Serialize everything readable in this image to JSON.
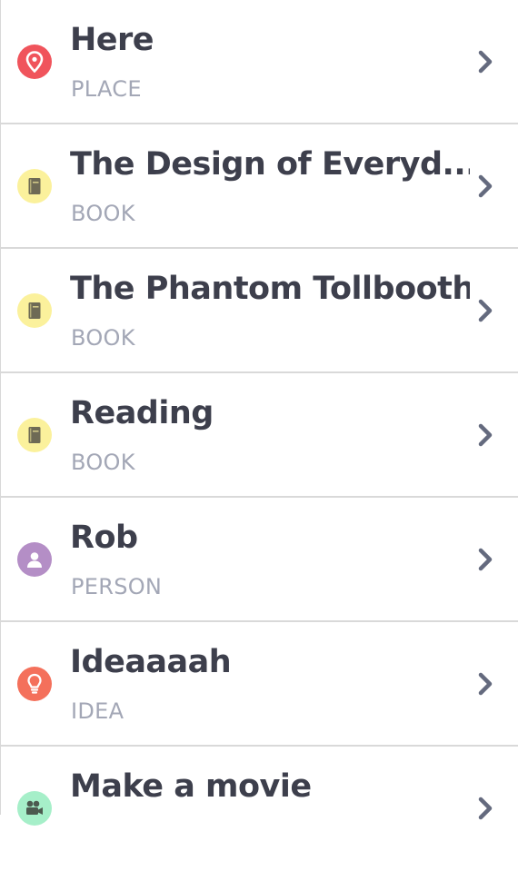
{
  "items": [
    {
      "title": "Here",
      "type": "PLACE",
      "icon": "location-pin-icon",
      "color": "#f0545c"
    },
    {
      "title": "The Design of Everyd...",
      "type": "BOOK",
      "icon": "book-icon",
      "color": "#fbf19c"
    },
    {
      "title": "The Phantom Tollbooth",
      "type": "BOOK",
      "icon": "book-icon",
      "color": "#fbf19c"
    },
    {
      "title": "Reading",
      "type": "BOOK",
      "icon": "book-icon",
      "color": "#fbf19c"
    },
    {
      "title": "Rob",
      "type": "PERSON",
      "icon": "person-icon",
      "color": "#b48ec6"
    },
    {
      "title": "Ideaaaah",
      "type": "IDEA",
      "icon": "lightbulb-icon",
      "color": "#f4705b"
    },
    {
      "title": "Make a movie",
      "type": "",
      "icon": "film-camera-icon",
      "color": "#a6efc9"
    }
  ],
  "chevron_icon": "chevron-right-icon"
}
